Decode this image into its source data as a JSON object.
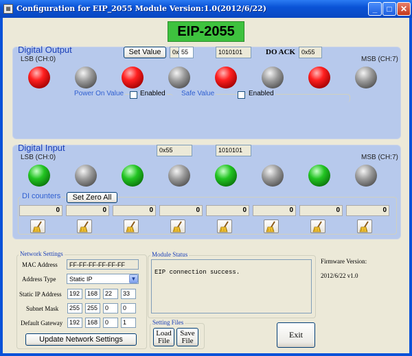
{
  "window": {
    "title": "Configuration for EIP_2055 Module Version:1.0(2012/6/22)",
    "controls": {
      "minimize": "_",
      "maximize": "□",
      "close": "✕"
    }
  },
  "banner": {
    "text": "EIP-2055",
    "color": "#3ec23e"
  },
  "digital_output": {
    "title": "Digital Output",
    "lsb_label": "LSB (CH:0)",
    "msb_label": "MSB (CH:7)",
    "set_value_label": "Set Value",
    "hex_prefix": "0x",
    "hex_value": "55",
    "binary_value": "1010101",
    "do_ack_label": "DO ACK",
    "do_ack_value": "0x55",
    "leds": [
      "red",
      "gray",
      "red",
      "gray",
      "red",
      "gray",
      "red",
      "gray"
    ],
    "power_on": {
      "title": "Power On Value",
      "checkbox_label": "Enabled",
      "checked": false
    },
    "safe_value": {
      "title": "Safe Value",
      "checkbox_label": "Enabled",
      "checked": false
    }
  },
  "digital_input": {
    "title": "Digital Input",
    "hex_value": "0x55",
    "binary_value": "1010101",
    "lsb_label": "LSB (CH:0)",
    "msb_label": "MSB (CH:7)",
    "leds": [
      "green",
      "gray",
      "green",
      "gray",
      "green",
      "gray",
      "green",
      "gray"
    ],
    "counters_title": "DI counters",
    "set_zero_all_label": "Set Zero All",
    "counters": [
      "0",
      "0",
      "0",
      "0",
      "0",
      "0",
      "0",
      "0"
    ]
  },
  "network": {
    "title": "Network Settings",
    "mac_label": "MAC Address",
    "mac_value": "FF-FF-FF-FF-FF-FF",
    "address_type_label": "Address Type",
    "address_type_value": "Static IP",
    "static_ip_label": "Static IP Address",
    "static_ip": [
      "192",
      "168",
      "22",
      "33"
    ],
    "subnet_label": "Subnet Mask",
    "subnet": [
      "255",
      "255",
      "0",
      "0"
    ],
    "gateway_label": "Default Gateway",
    "gateway": [
      "192",
      "168",
      "0",
      "1"
    ],
    "update_label": "Update Network Settings"
  },
  "module_status": {
    "title": "Module Status",
    "message": "EIP connection success."
  },
  "firmware": {
    "label": "Firmware Version:",
    "value": "2012/6/22 v1.0"
  },
  "setting_files": {
    "title": "Setting Files",
    "load_label_1": "Load",
    "load_label_2": "File",
    "save_label_1": "Save",
    "save_label_2": "File"
  },
  "exit_label": "Exit",
  "colors": {
    "title_bar": "#0a53d6",
    "panel": "#b7c9ec",
    "group_title": "#1a3fb8",
    "led_on_output": "#ff2020",
    "led_on_input": "#22c422"
  }
}
